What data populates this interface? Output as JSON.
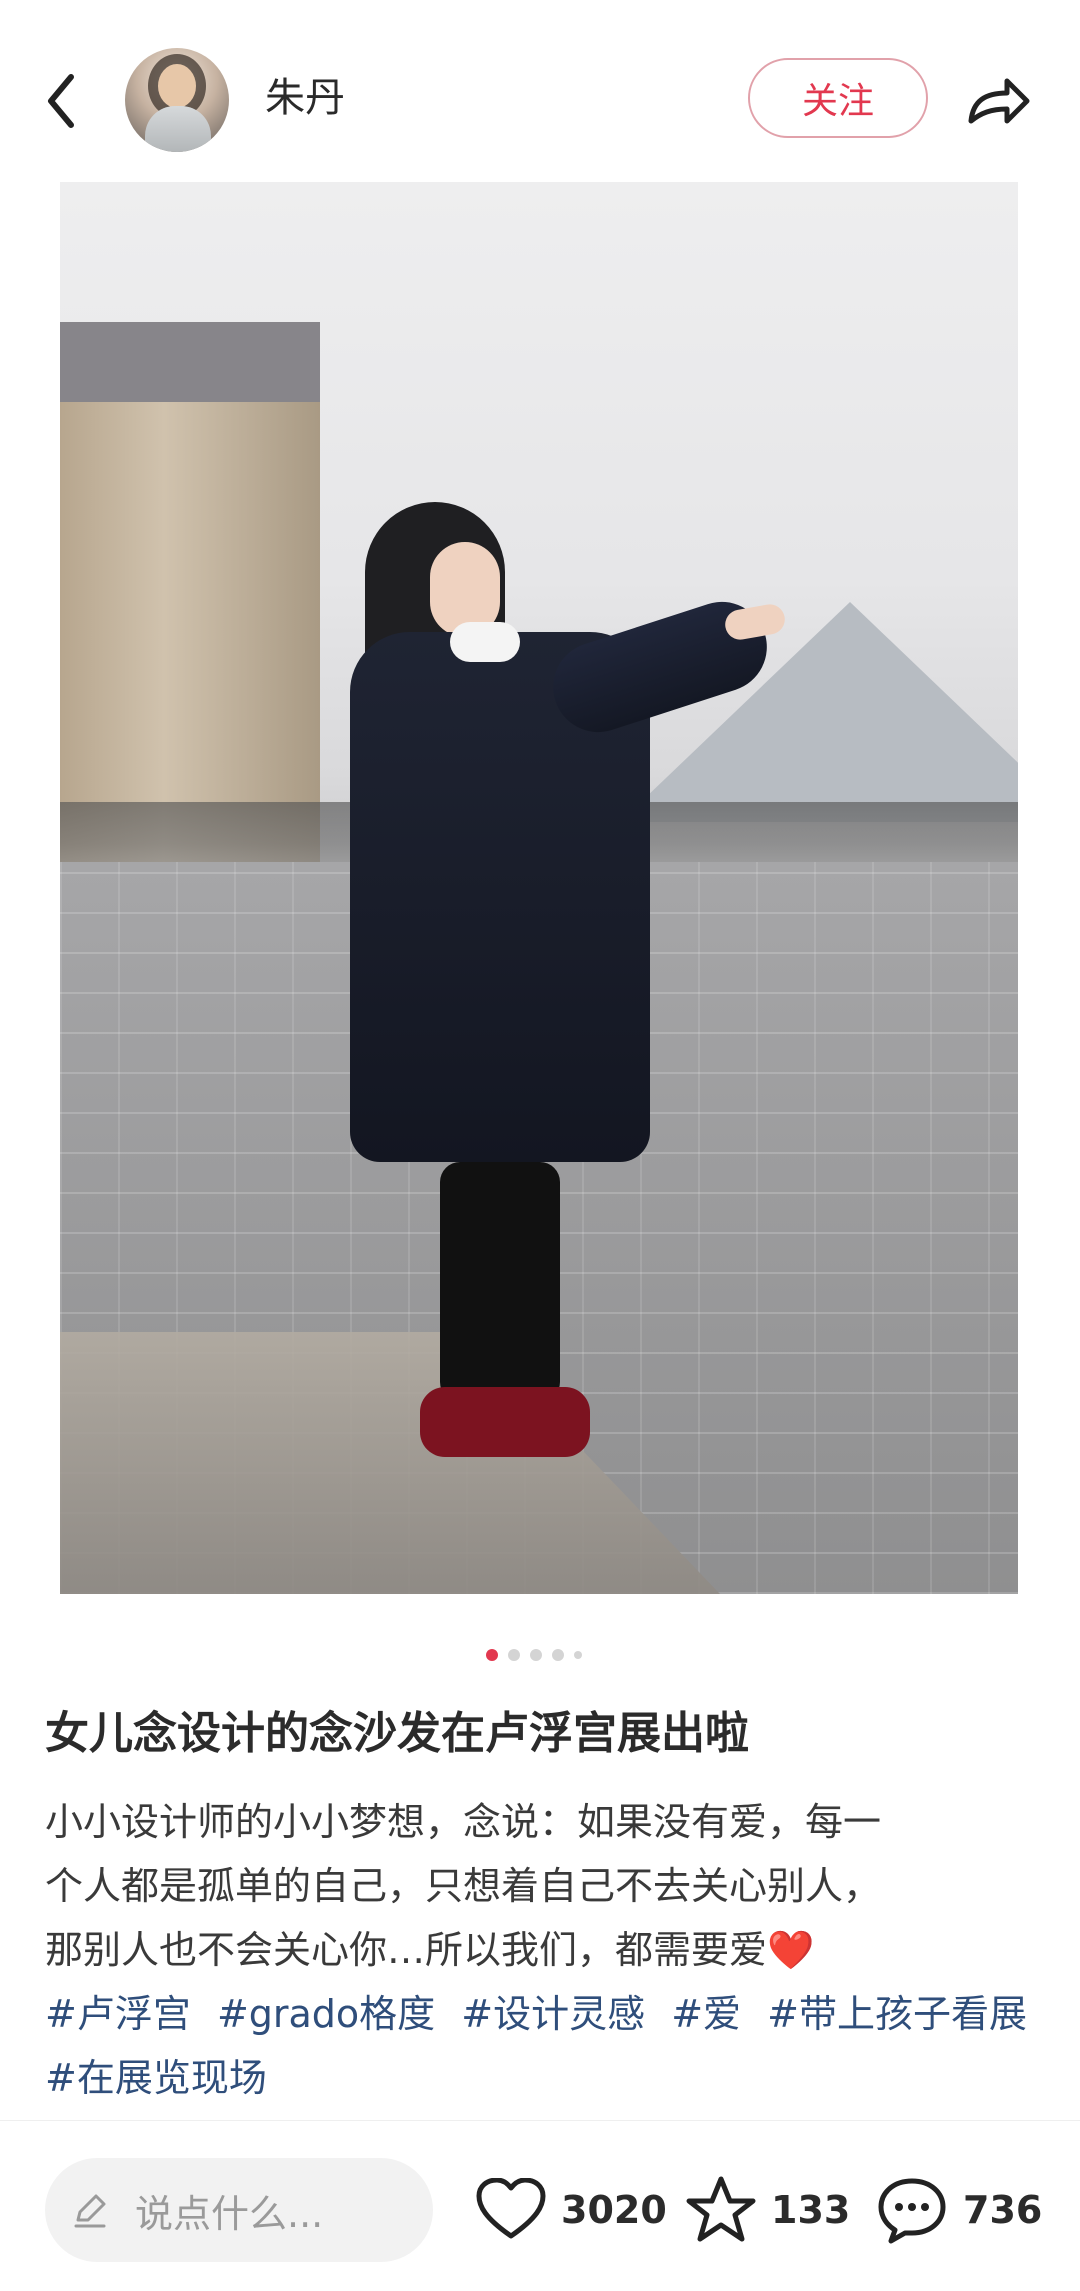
{
  "header": {
    "username": "朱丹",
    "follow_label": "关注"
  },
  "pager": {
    "active_index": 0,
    "total_dots_visible": 5
  },
  "post": {
    "title": "女儿念设计的念沙发在卢浮宫展出啦",
    "body_line1": "小小设计师的小小梦想，念说：如果没有爱，每一",
    "body_line2": "个人都是孤单的自己，只想着自己不去关心别人，",
    "body_line3": "那别人也不会关心你…所以我们，都需要爱",
    "emoji": "❤️",
    "tags": [
      "#卢浮宫",
      "#grado格度",
      "#设计灵感",
      "#爱",
      "#带上孩子看展",
      "#在展览现场"
    ]
  },
  "bottom_bar": {
    "comment_placeholder": "说点什么...",
    "likes": "3020",
    "favorites": "133",
    "comments": "736"
  },
  "colors": {
    "accent": "#e2384f",
    "tag_text": "#2f4e7b"
  },
  "icons": {
    "back": "chevron-left-icon",
    "share": "share-arrow-icon",
    "edit": "pencil-icon",
    "like": "heart-icon",
    "favorite": "star-icon",
    "comment": "chat-bubble-icon"
  }
}
